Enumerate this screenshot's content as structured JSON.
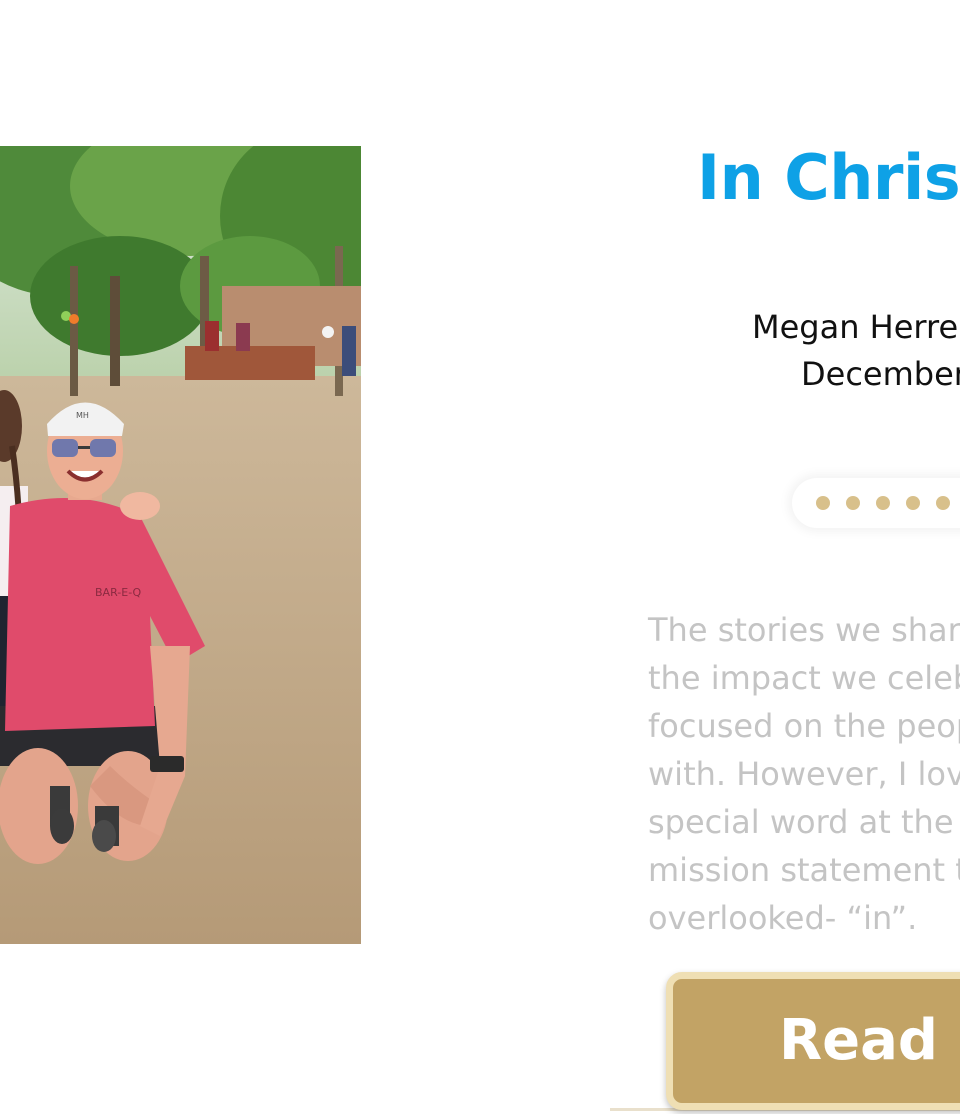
{
  "post": {
    "title": "In Christ",
    "author": "Megan Herre",
    "date": "December",
    "photo_icon": "photo-of-woman-and-child",
    "excerpt_lines": [
      "The stories we share",
      "the impact we celeb",
      "focused on the peop",
      "with. However, I love",
      "special word at the s",
      "mission statement t",
      "overlooked- “in”."
    ],
    "read_more_label": "Read M"
  },
  "colors": {
    "title": "#0ea1e6",
    "accent_gold": "#c2a365",
    "dot_gold": "#d8c08b",
    "excerpt_gray": "#c4c4c4"
  },
  "dots_count": 5
}
